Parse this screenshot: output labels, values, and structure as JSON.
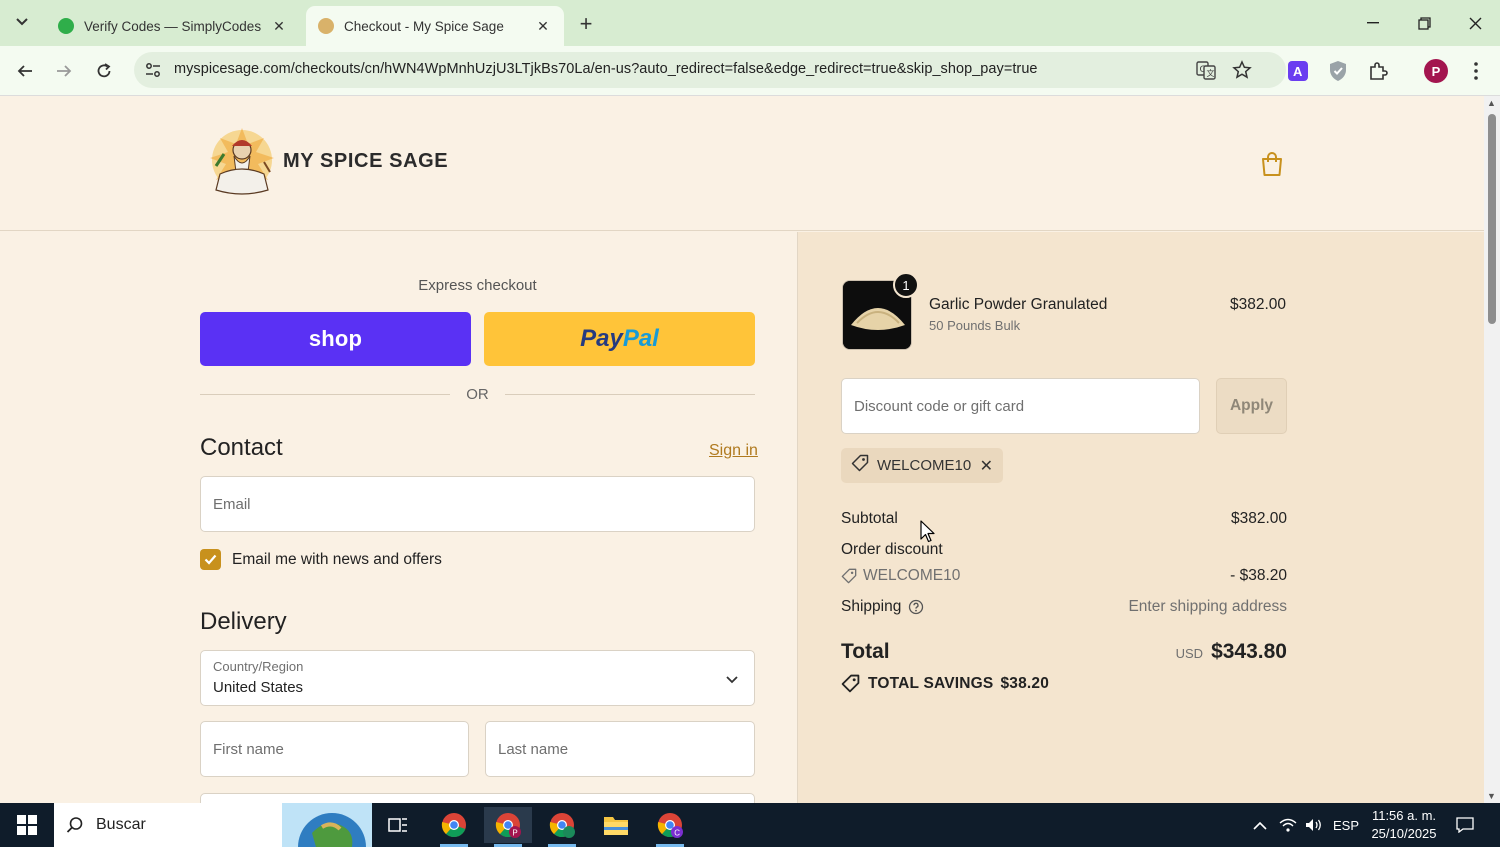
{
  "browser": {
    "tabs": [
      {
        "title": "Verify Codes — SimplyCodes",
        "active": false
      },
      {
        "title": "Checkout - My Spice Sage",
        "active": true
      }
    ],
    "url": "myspicesage.com/checkouts/cn/hWN4WpMnhUzjU3LTjkBs70La/en-us?auto_redirect=false&edge_redirect=true&skip_shop_pay=true",
    "profile_initial": "P"
  },
  "header": {
    "brand": "MY SPICE SAGE"
  },
  "express": {
    "label": "Express checkout",
    "shop_label": "shop",
    "paypal_label_1": "Pay",
    "paypal_label_2": "Pal",
    "or": "OR"
  },
  "contact": {
    "title": "Contact",
    "sign_in": "Sign in",
    "email_placeholder": "Email",
    "newsletter_label": "Email me with news and offers",
    "newsletter_checked": true
  },
  "delivery": {
    "title": "Delivery",
    "country_label": "Country/Region",
    "country_value": "United States",
    "first_name_placeholder": "First name",
    "last_name_placeholder": "Last name"
  },
  "order": {
    "item": {
      "name": "Garlic Powder Granulated",
      "variant": "50 Pounds Bulk",
      "price": "$382.00",
      "quantity": "1"
    },
    "discount_placeholder": "Discount code or gift card",
    "apply_label": "Apply",
    "applied_code": "WELCOME10",
    "subtotal_label": "Subtotal",
    "subtotal_value": "$382.00",
    "order_discount_label": "Order discount",
    "discount_code": "WELCOME10",
    "discount_value": "- $38.20",
    "shipping_label": "Shipping",
    "shipping_value": "Enter shipping address",
    "total_label": "Total",
    "total_currency": "USD",
    "total_value": "$343.80",
    "savings_label": "TOTAL SAVINGS",
    "savings_value": "$38.20"
  },
  "taskbar": {
    "search_text": "Buscar",
    "language": "ESP",
    "time": "11:56 a. m.",
    "date": "25/10/2025"
  },
  "colors": {
    "page_bg": "#faf1e4",
    "summary_bg": "#f4e5cf",
    "shop_purple": "#5a31f4",
    "paypal_yellow": "#ffc439",
    "accent": "#c8911d"
  }
}
